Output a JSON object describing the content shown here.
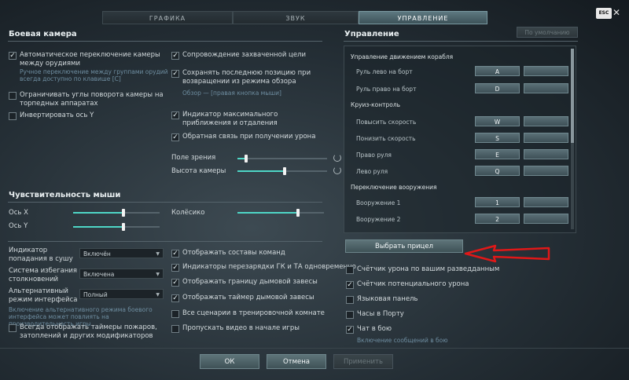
{
  "tabs": [
    "ГРАФИКА",
    "ЗВУК",
    "УПРАВЛЕНИЕ"
  ],
  "esc_label": "ESC",
  "camera": {
    "title": "Боевая камера",
    "auto_switch": "Автоматическое переключение камеры между орудиями",
    "auto_switch_sub": "Ручное переключение между группами орудий всегда доступно по клавише [C]",
    "limit_angles": "Ограничивать углы поворота камеры на торпедных аппаратах",
    "invert_y": "Инвертировать ось Y",
    "track_target": "Сопровождение захваченной цели",
    "save_position": "Сохранять последнюю позицию при возвращении из режима обзора",
    "view_hint": "Обзор — [правая кнопка мыши]",
    "max_zoom": "Индикатор максимального приближения и отдаления",
    "damage_feedback": "Обратная связь при получении урона",
    "fov_label": "Поле зрения",
    "height_label": "Высота камеры",
    "fov_level": 0.1,
    "height_level": 0.53
  },
  "mouse": {
    "title": "Чувствительность мыши",
    "axis_x": "Ось X",
    "axis_y": "Ось Y",
    "wheel": "Колёсико",
    "x_level": 0.58,
    "y_level": 0.58,
    "wheel_level": 0.7
  },
  "misc": {
    "hit_indicator": "Индикатор попадания в сушу",
    "hit_indicator_value": "Включён",
    "collision": "Система избегания столкновений",
    "collision_value": "Включена",
    "alt_mode": "Альтернативный режим интерфейса",
    "alt_mode_value": "Полный",
    "alt_mode_note": "Включение альтернативного режима боевого интерфейса может повлиять на производительность игры",
    "timers": "Всегда отображать таймеры пожаров, затоплений и других модификаторов",
    "team_comp": "Отображать составы команд",
    "reload": "Индикаторы перезарядки ГК и ТА одновременно",
    "smoke": "Отображать границу дымовой завесы",
    "smoke_timer": "Отображать таймер дымовой завесы",
    "training": "Все сценарии в тренировочной комнате",
    "skip_video": "Пропускать видео в начале игры"
  },
  "controls": {
    "title": "Управление",
    "default_button": "По умолчанию",
    "group_steering": "Управление движением корабля",
    "rudder_left": "Руль лево на борт",
    "rudder_left_key": "A",
    "rudder_right": "Руль право на борт",
    "rudder_right_key": "D",
    "group_cruise": "Круиз-контроль",
    "speed_up": "Повысить скорость",
    "speed_up_key": "W",
    "speed_down": "Понизить скорость",
    "speed_down_key": "S",
    "rudder_r": "Право руля",
    "rudder_r_key": "E",
    "rudder_l": "Лево руля",
    "rudder_l_key": "Q",
    "group_weapons": "Переключение вооружения",
    "weapon1": "Вооружение 1",
    "weapon1_key": "1",
    "weapon2": "Вооружение 2",
    "weapon2_key": "2",
    "choose_sight": "Выбрать прицел"
  },
  "right_opts": {
    "damage_scouted": "Счётчик урона по вашим разведданным",
    "potential_damage": "Счётчик потенциального урона",
    "language_panel": "Языковая панель",
    "port_clock": "Часы в Порту",
    "battle_chat": "Чат в бою",
    "chat_note": "Включение сообщений в бою"
  },
  "footer": {
    "ok": "ОК",
    "cancel": "Отмена",
    "apply": "Применить"
  },
  "colors": {
    "accent": "#4ed6c6",
    "arrow": "#e01818"
  }
}
